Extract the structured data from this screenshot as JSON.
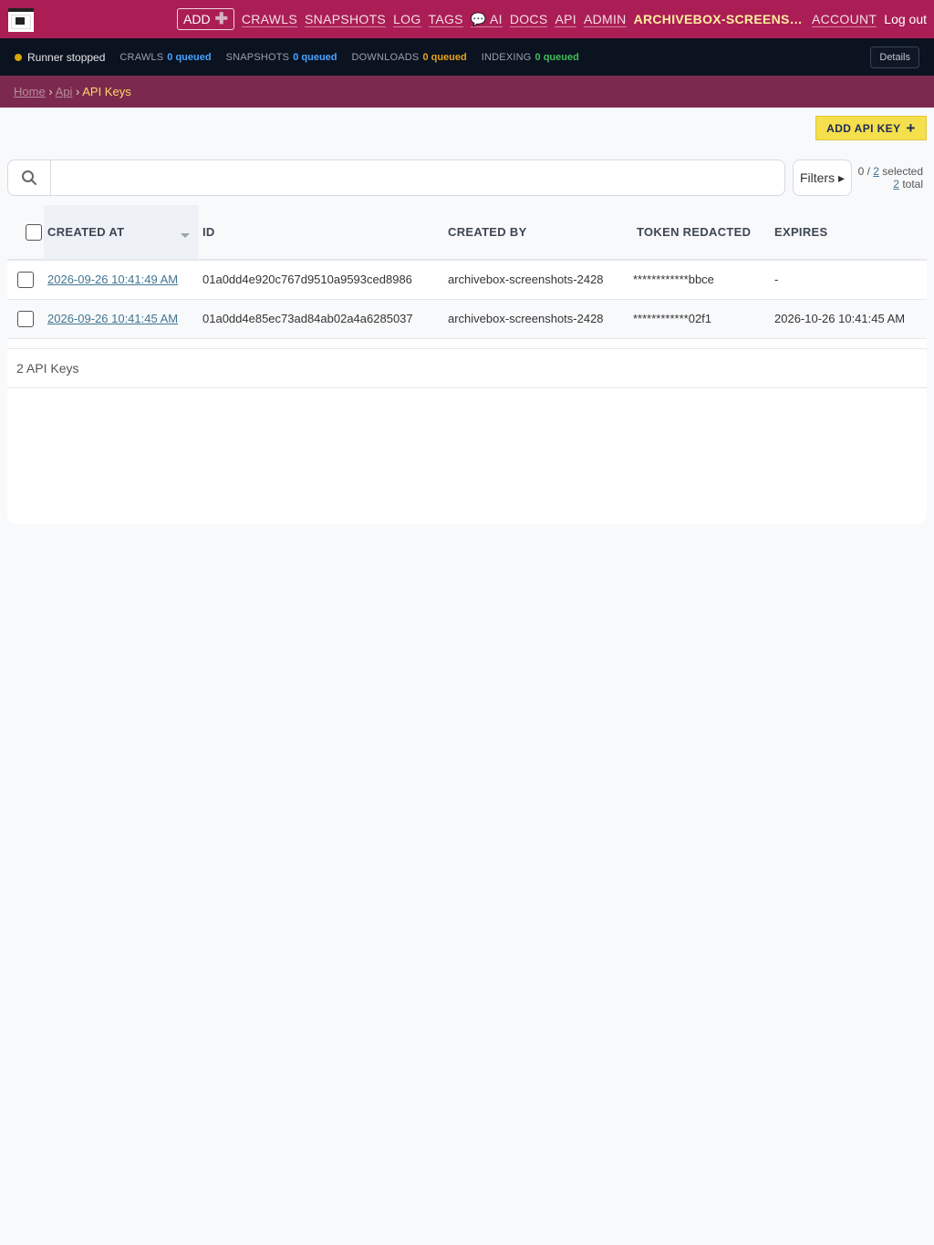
{
  "nav": {
    "add": "ADD",
    "links": [
      "CRAWLS",
      "SNAPSHOTS",
      "LOG",
      "TAGS",
      "💬 AI",
      "DOCS",
      "API",
      "ADMIN"
    ],
    "user": "ARCHIVEBOX-SCREENS…",
    "account": "ACCOUNT",
    "logout": "Log out"
  },
  "status": {
    "runner": "Runner stopped",
    "queues": [
      {
        "label": "CRAWLS",
        "value": "0 queued",
        "color": "#4aa3ff"
      },
      {
        "label": "SNAPSHOTS",
        "value": "0 queued",
        "color": "#4aa3ff"
      },
      {
        "label": "DOWNLOADS",
        "value": "0 queued",
        "color": "#e7a21a"
      },
      {
        "label": "INDEXING",
        "value": "0 queued",
        "color": "#3fbf5a"
      }
    ],
    "details": "Details"
  },
  "breadcrumb": {
    "home": "Home",
    "api": "Api",
    "current": "API Keys",
    "sep": "›"
  },
  "toolbar": {
    "add_label": "ADD API KEY",
    "filters": "Filters ▸"
  },
  "selection": {
    "selected_prefix": "0 / ",
    "selected_count": "2",
    "selected_suffix": " selected",
    "total_count": "2",
    "total_suffix": " total"
  },
  "table": {
    "headers": [
      "CREATED AT",
      "ID",
      "CREATED BY",
      "TOKEN REDACTED",
      "EXPIRES"
    ],
    "rows": [
      {
        "created_at": "2026-09-26 10:41:49 AM",
        "id": "01a0dd4e920c767d9510a9593ced8986",
        "created_by": "archivebox-screenshots-2428",
        "token": "************bbce",
        "expires": "-"
      },
      {
        "created_at": "2026-09-26 10:41:45 AM",
        "id": "01a0dd4e85ec73ad84ab02a4a6285037",
        "created_by": "archivebox-screenshots-2428",
        "token": "************02f1",
        "expires": "2026-10-26 10:41:45 AM"
      }
    ],
    "count": "2 API Keys"
  }
}
